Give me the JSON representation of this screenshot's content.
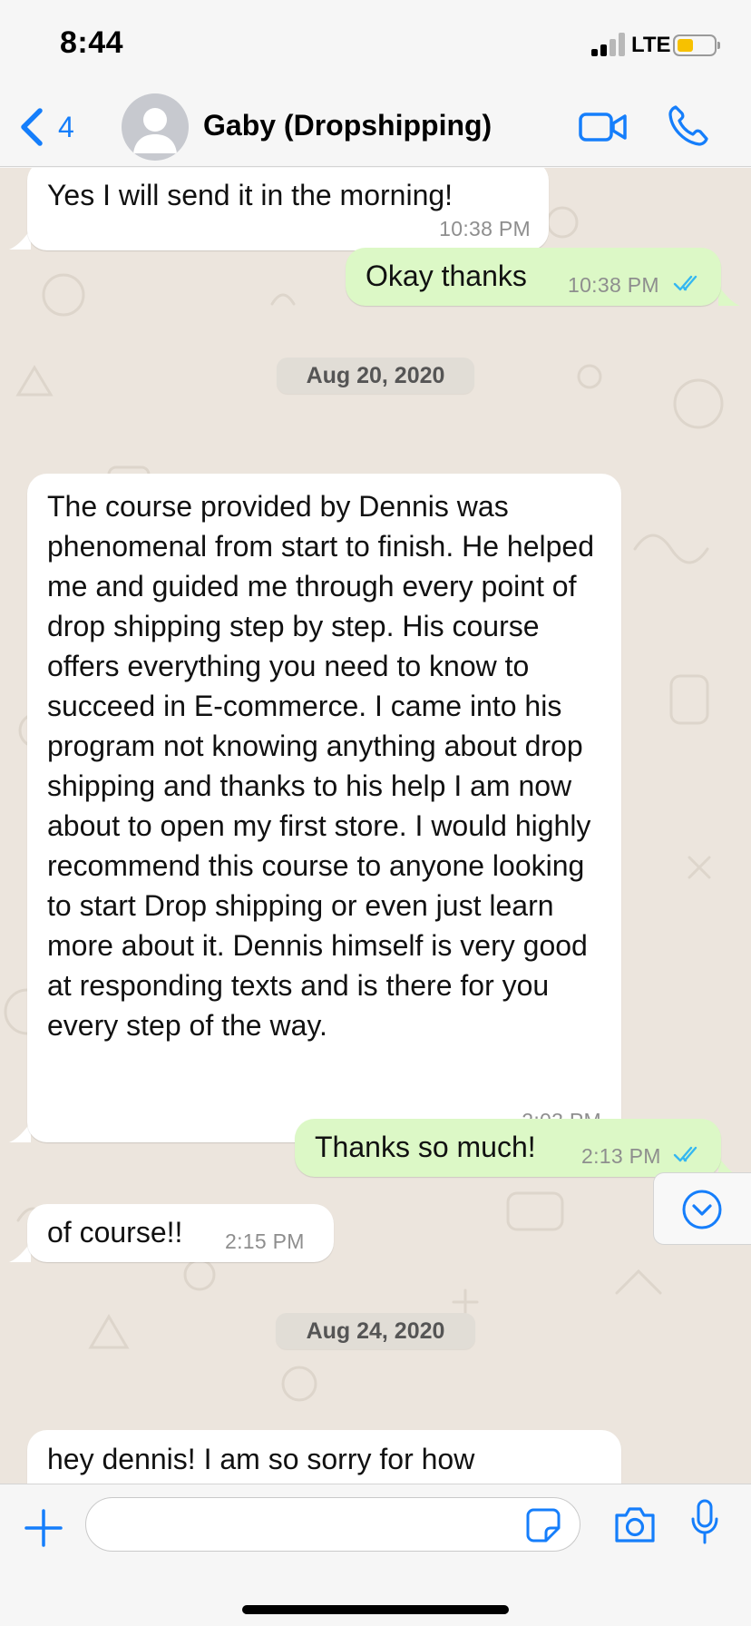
{
  "status_bar": {
    "time": "8:44",
    "network": "LTE",
    "battery_level": 0.45,
    "battery_color": "#f7c100"
  },
  "header": {
    "back_count": "4",
    "contact_name": "Gaby (Dropshipping)",
    "accent_color": "#157efb",
    "icons": [
      "chevron-left-icon",
      "avatar-placeholder-icon",
      "video-camera-icon",
      "phone-icon"
    ]
  },
  "messages": [
    {
      "id": "m1",
      "direction": "incoming",
      "text": "Yes I will send it in the morning!",
      "time": "10:38 PM"
    },
    {
      "id": "m2",
      "direction": "outgoing",
      "text": "Okay thanks",
      "time": "10:38 PM",
      "status": "read"
    },
    {
      "id": "d1",
      "type": "date",
      "label": "Aug 20, 2020"
    },
    {
      "id": "m3",
      "direction": "incoming",
      "text": "The course provided by Dennis was phenomenal from start to finish. He helped me and guided me through every point of drop shipping step by step. His course offers everything you need to know to succeed in E-commerce. I came into his program not knowing anything about drop shipping and thanks to his help I am now about to open my first store. I would highly recommend this course to anyone looking to start Drop shipping or even just learn more about it. Dennis himself is very good at responding texts and is there for you every step of the way.",
      "time": "2:03 PM"
    },
    {
      "id": "m4",
      "direction": "outgoing",
      "text": "Thanks so much!",
      "time": "2:13 PM",
      "status": "read"
    },
    {
      "id": "m5",
      "direction": "incoming",
      "text": "of course!!",
      "time": "2:15 PM"
    },
    {
      "id": "d2",
      "type": "date",
      "label": "Aug 24, 2020"
    },
    {
      "id": "m6",
      "direction": "incoming",
      "text": "hey dennis! I am so sorry for how"
    }
  ],
  "colors": {
    "incoming_bubble": "#ffffff",
    "outgoing_bubble": "#dcf8c6",
    "chat_background": "#ece5dd",
    "read_ticks": "#34b7f1"
  },
  "input_bar": {
    "message_value": "",
    "icons": [
      "plus-icon",
      "sticker-icon",
      "camera-icon",
      "microphone-icon"
    ]
  }
}
